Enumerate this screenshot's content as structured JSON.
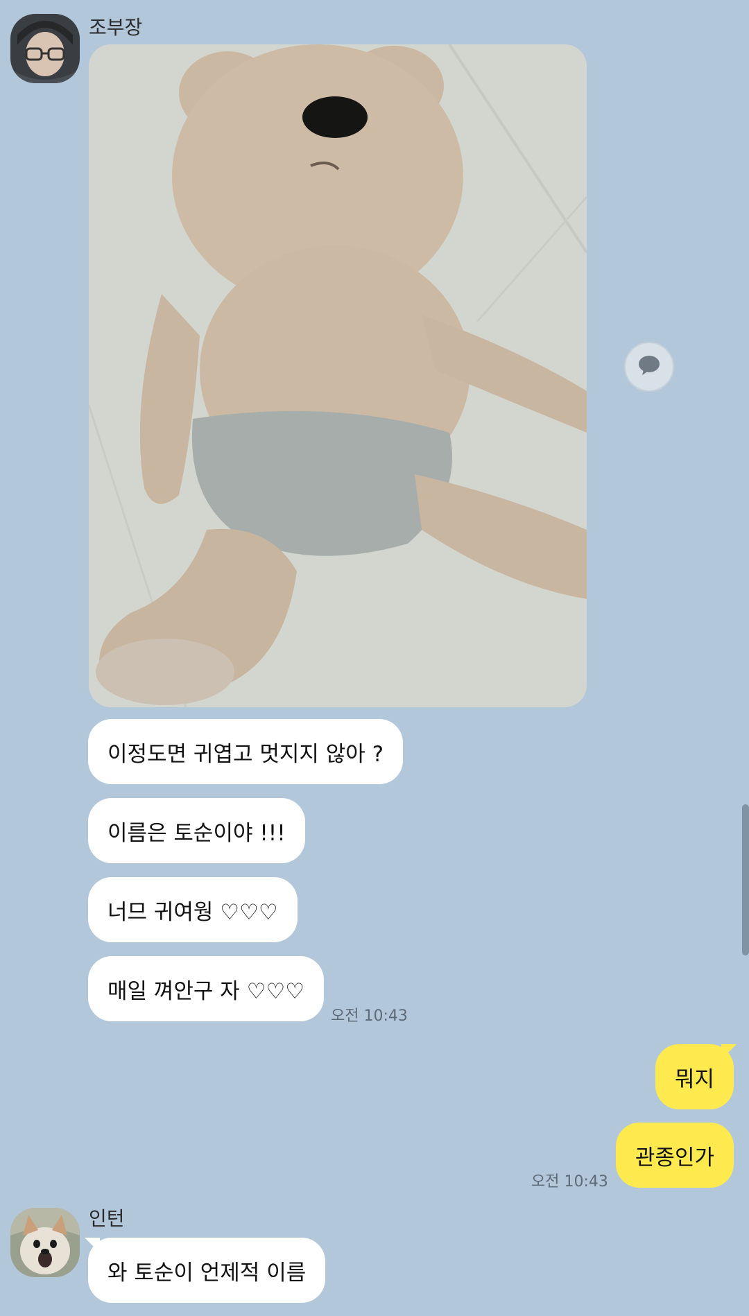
{
  "messages": {
    "sender1": {
      "name": "조부장",
      "lines": [
        "이정도면 귀엽고 멋지지 않아 ?",
        "이름은 토순이야 !!!",
        "너므 귀여웡 ♡♡♡",
        "매일 껴안구 자 ♡♡♡"
      ],
      "time": "오전 10:43"
    },
    "me": {
      "lines": [
        "뭐지",
        "관종인가"
      ],
      "time": "오전 10:43"
    },
    "sender2": {
      "name": "인턴",
      "lines": [
        "와 토순이 언제적 이름"
      ]
    }
  },
  "colors": {
    "background": "#b2c7da",
    "incoming_bubble": "#ffffff",
    "outgoing_bubble": "#fee94e"
  },
  "icons": {
    "comment_button": "speech-bubble-icon"
  }
}
